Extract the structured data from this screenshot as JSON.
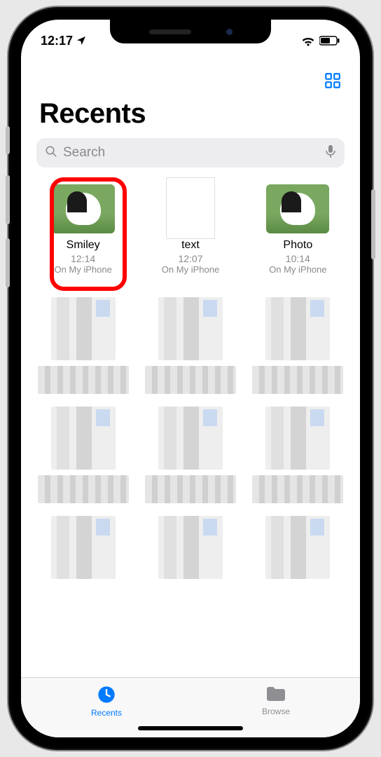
{
  "status": {
    "time": "12:17"
  },
  "header": {
    "title": "Recents"
  },
  "search": {
    "placeholder": "Search"
  },
  "files": [
    {
      "name": "Smiley",
      "time": "12:14",
      "location": "On My iPhone",
      "kind": "dog",
      "highlighted": true
    },
    {
      "name": "text",
      "time": "12:07",
      "location": "On My iPhone",
      "kind": "doc",
      "highlighted": false
    },
    {
      "name": "Photo",
      "time": "10:14",
      "location": "On My iPhone",
      "kind": "dog",
      "highlighted": false
    }
  ],
  "tabs": {
    "recents": "Recents",
    "browse": "Browse"
  }
}
